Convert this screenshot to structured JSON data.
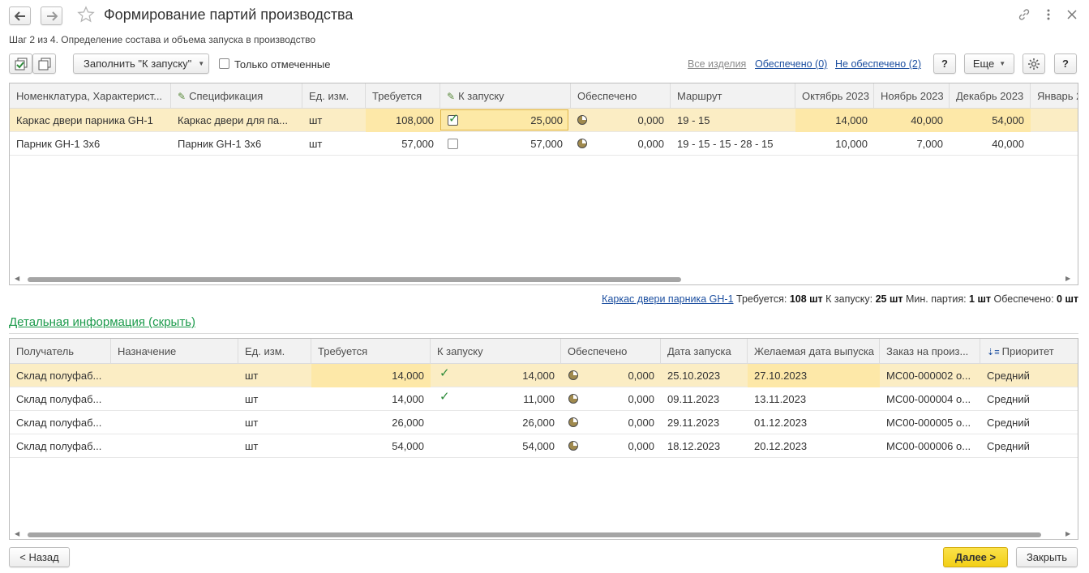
{
  "window": {
    "title": "Формирование партий производства",
    "subtitle": "Шаг 2 из 4. Определение состава и объема запуска в производство"
  },
  "toolbar": {
    "fill_label": "Заполнить \"К запуску\"",
    "only_marked_label": "Только отмеченные",
    "filter_all": "Все изделия",
    "filter_provided": "Обеспечено (0)",
    "filter_not_provided": "Не обеспечено (2)",
    "help_label": "?",
    "more_label": "Еще",
    "help2_label": "?"
  },
  "main_table": {
    "columns": [
      "Номенклатура, Характерист...",
      "Спецификация",
      "Ед. изм.",
      "Требуется",
      "К запуску",
      "Обеспечено",
      "Маршрут",
      "Октябрь 2023",
      "Ноябрь 2023",
      "Декабрь 2023",
      "Январь 2"
    ],
    "rows": [
      {
        "name": "Каркас двери парника GH-1",
        "spec": "Каркас двери для па...",
        "unit": "шт",
        "required": "108,000",
        "checked": true,
        "to_launch": "25,000",
        "provided": "0,000",
        "route": "19 - 15",
        "oct": "14,000",
        "nov": "40,000",
        "dec": "54,000"
      },
      {
        "name": "Парник GH-1 3х6",
        "spec": "Парник GH-1 3х6",
        "unit": "шт",
        "required": "57,000",
        "checked": false,
        "to_launch": "57,000",
        "provided": "0,000",
        "route": "19 - 15 - 15 - 28 - 15",
        "oct": "10,000",
        "nov": "7,000",
        "dec": "40,000"
      }
    ]
  },
  "status": {
    "item_link": "Каркас двери парника GH-1",
    "required_label": "Требуется:",
    "required_value": "108 шт",
    "launch_label": "К запуску:",
    "launch_value": "25 шт",
    "min_batch_label": "Мин. партия:",
    "min_batch_value": "1 шт",
    "provided_label": "Обеспечено:",
    "provided_value": "0 шт"
  },
  "detail": {
    "toggle_label": "Детальная информация (скрыть)",
    "columns": [
      "Получатель",
      "Назначение",
      "Ед. изм.",
      "Требуется",
      "К запуску",
      "Обеспечено",
      "Дата запуска",
      "Желаемая дата выпуска",
      "Заказ на произ...",
      "Приоритет"
    ],
    "rows": [
      {
        "recipient": "Склад полуфаб...",
        "purpose": "",
        "unit": "шт",
        "required": "14,000",
        "checked": true,
        "to_launch": "14,000",
        "provided": "0,000",
        "start": "25.10.2023",
        "desired": "27.10.2023",
        "order": "МС00-000002 о...",
        "priority": "Средний"
      },
      {
        "recipient": "Склад полуфаб...",
        "purpose": "",
        "unit": "шт",
        "required": "14,000",
        "checked": true,
        "to_launch": "11,000",
        "provided": "0,000",
        "start": "09.11.2023",
        "desired": "13.11.2023",
        "order": "МС00-000004 о...",
        "priority": "Средний"
      },
      {
        "recipient": "Склад полуфаб...",
        "purpose": "",
        "unit": "шт",
        "required": "26,000",
        "checked": false,
        "to_launch": "26,000",
        "provided": "0,000",
        "start": "29.11.2023",
        "desired": "01.12.2023",
        "order": "МС00-000005 о...",
        "priority": "Средний"
      },
      {
        "recipient": "Склад полуфаб...",
        "purpose": "",
        "unit": "шт",
        "required": "54,000",
        "checked": false,
        "to_launch": "54,000",
        "provided": "0,000",
        "start": "18.12.2023",
        "desired": "20.12.2023",
        "order": "МС00-000006 о...",
        "priority": "Средний"
      }
    ]
  },
  "footer": {
    "back_label": "< Назад",
    "next_label": "Далее >",
    "close_label": "Закрыть"
  },
  "colors": {
    "accent_yellow": "#f7d22e",
    "selected_row": "#fbedc4",
    "link_blue": "#1c4fa0",
    "detail_green": "#1a9a4a"
  }
}
